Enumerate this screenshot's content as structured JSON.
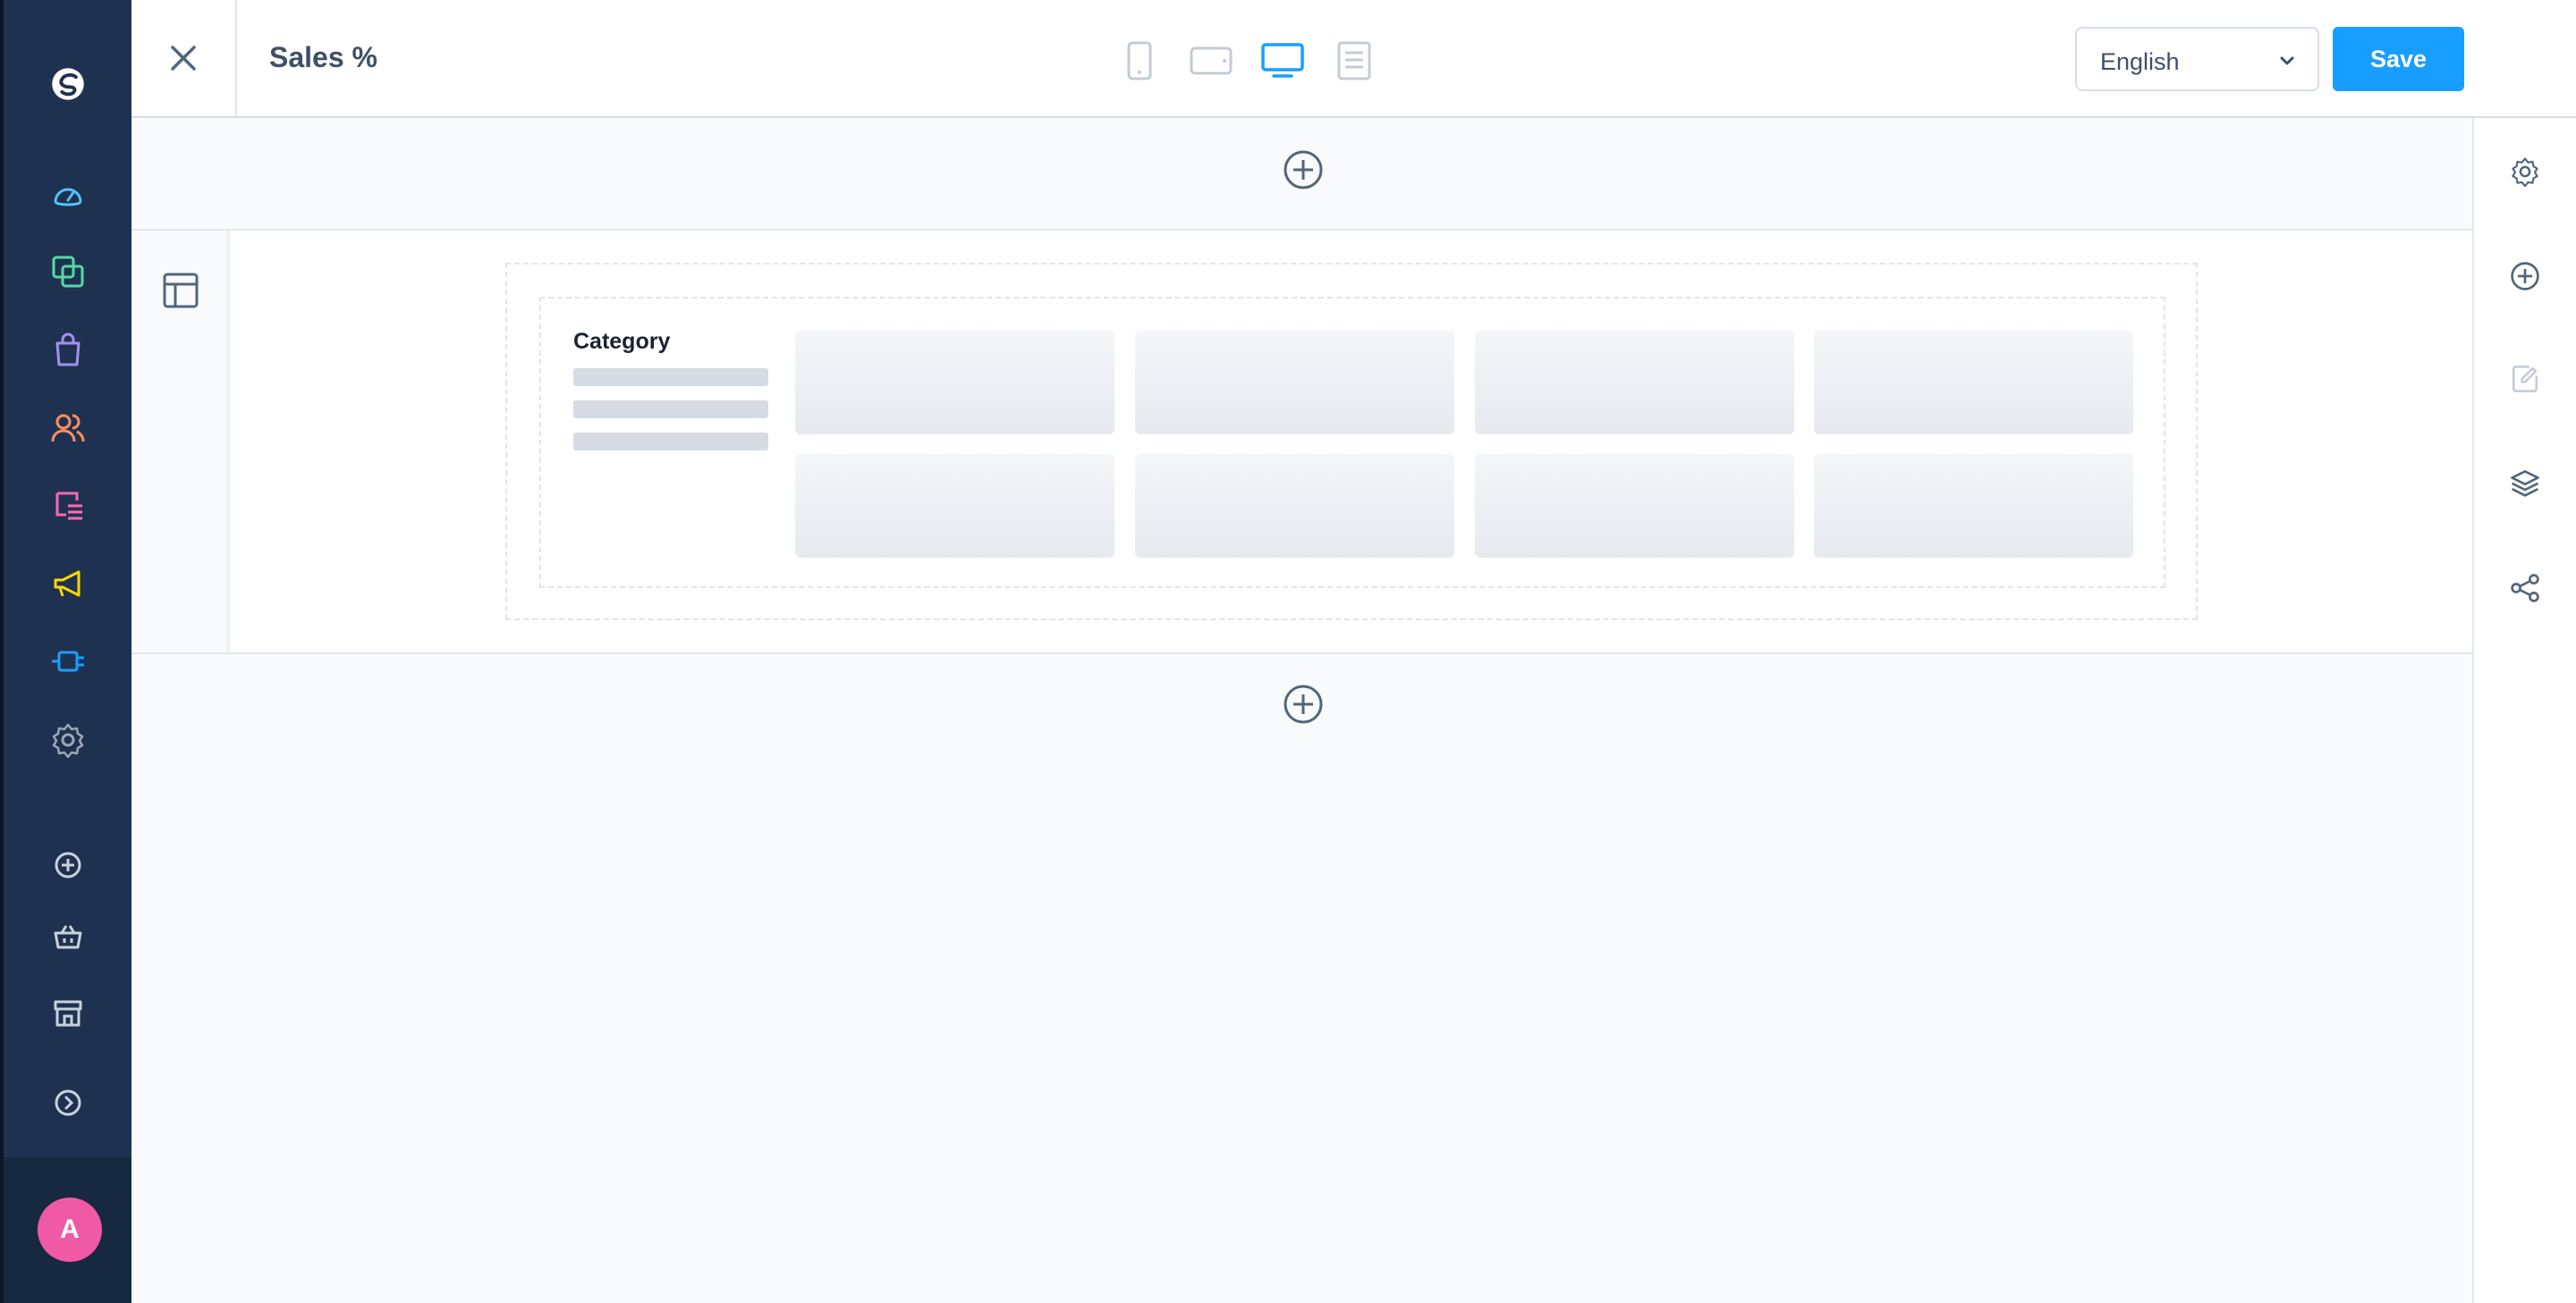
{
  "header": {
    "title": "Sales %",
    "language": {
      "selected": "English"
    },
    "save_label": "Save",
    "devices": [
      {
        "name": "mobile",
        "active": false
      },
      {
        "name": "tablet",
        "active": false
      },
      {
        "name": "desktop",
        "active": true
      },
      {
        "name": "form",
        "active": false
      }
    ]
  },
  "sidebar": {
    "items": [
      {
        "name": "dashboard",
        "color": "#4fc3f7"
      },
      {
        "name": "catalogues",
        "color": "#57d9a3"
      },
      {
        "name": "orders",
        "color": "#a092f0"
      },
      {
        "name": "customers",
        "color": "#ff8f5e"
      },
      {
        "name": "content",
        "color": "#ff68b4"
      },
      {
        "name": "marketing",
        "color": "#ffd700"
      },
      {
        "name": "extensions",
        "color": "#189eff"
      },
      {
        "name": "settings",
        "color": "#9aa8b5"
      }
    ],
    "secondary": [
      "add",
      "basket",
      "storefront",
      "expand"
    ],
    "avatar_initial": "A",
    "avatar_color": "#f05aa4"
  },
  "block": {
    "category_title": "Category",
    "sidebar_lines": 3,
    "product_rows": 2,
    "product_columns": 4
  },
  "right_rail": [
    "settings",
    "add",
    "edit",
    "layers",
    "share"
  ],
  "colors": {
    "accent": "#189eff",
    "sidebar_bg": "#1f3150",
    "canvas_bg": "#f9fafb"
  }
}
